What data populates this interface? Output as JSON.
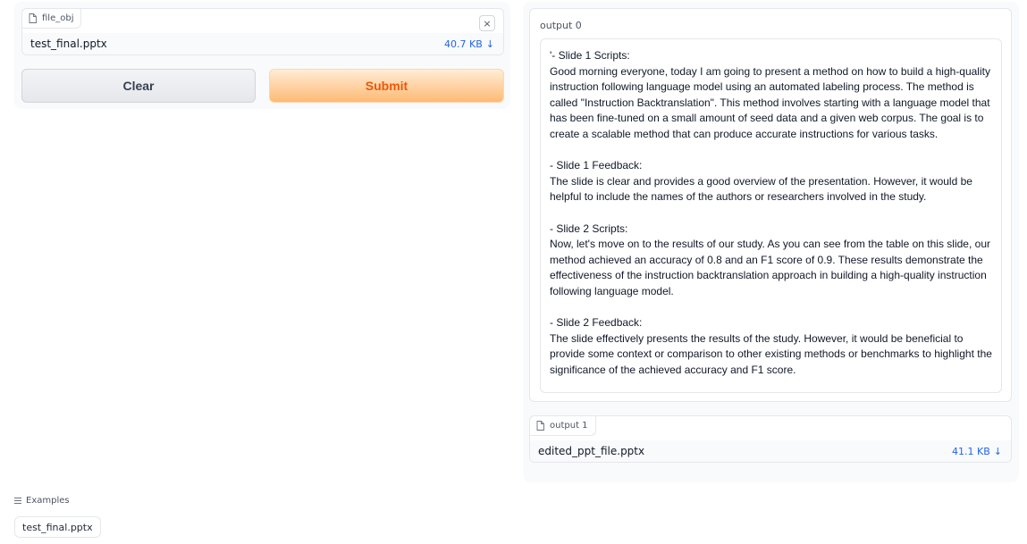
{
  "inputs": {
    "file_label": "file_obj",
    "file_name": "test_final.pptx",
    "file_size": "40.7 KB",
    "clear_icon": "×",
    "download_icon": "↓"
  },
  "buttons": {
    "clear": "Clear",
    "submit": "Submit"
  },
  "examples": {
    "header": "Examples",
    "items": [
      "test_final.pptx"
    ]
  },
  "outputs": {
    "output0_label": "output 0",
    "output0_text": "'- Slide 1 Scripts:\nGood morning everyone, today I am going to present a method on how to build a high-quality instruction following language model using an automated labeling process. The method is called \"Instruction Backtranslation\". This method involves starting with a language model that has been fine-tuned on a small amount of seed data and a given web corpus. The goal is to create a scalable method that can produce accurate instructions for various tasks.\n\n- Slide 1 Feedback:\nThe slide is clear and provides a good overview of the presentation. However, it would be helpful to include the names of the authors or researchers involved in the study.\n\n- Slide 2 Scripts:\nNow, let's move on to the results of our study. As you can see from the table on this slide, our method achieved an accuracy of 0.8 and an F1 score of 0.9. These results demonstrate the effectiveness of the instruction backtranslation approach in building a high-quality instruction following language model.\n\n- Slide 2 Feedback:\nThe slide effectively presents the results of the study. However, it would be beneficial to provide some context or comparison to other existing methods or benchmarks to highlight the significance of the achieved accuracy and F1 score.",
    "output1_label": "output 1",
    "output1_file_name": "edited_ppt_file.pptx",
    "output1_file_size": "41.1 KB"
  },
  "icons": {
    "file": "file-icon",
    "close": "close-icon",
    "download": "download-icon",
    "list": "list-icon"
  },
  "colors": {
    "accent_link": "#2563eb",
    "submit_text": "#ea580c",
    "submit_bg": "#fdba74"
  }
}
